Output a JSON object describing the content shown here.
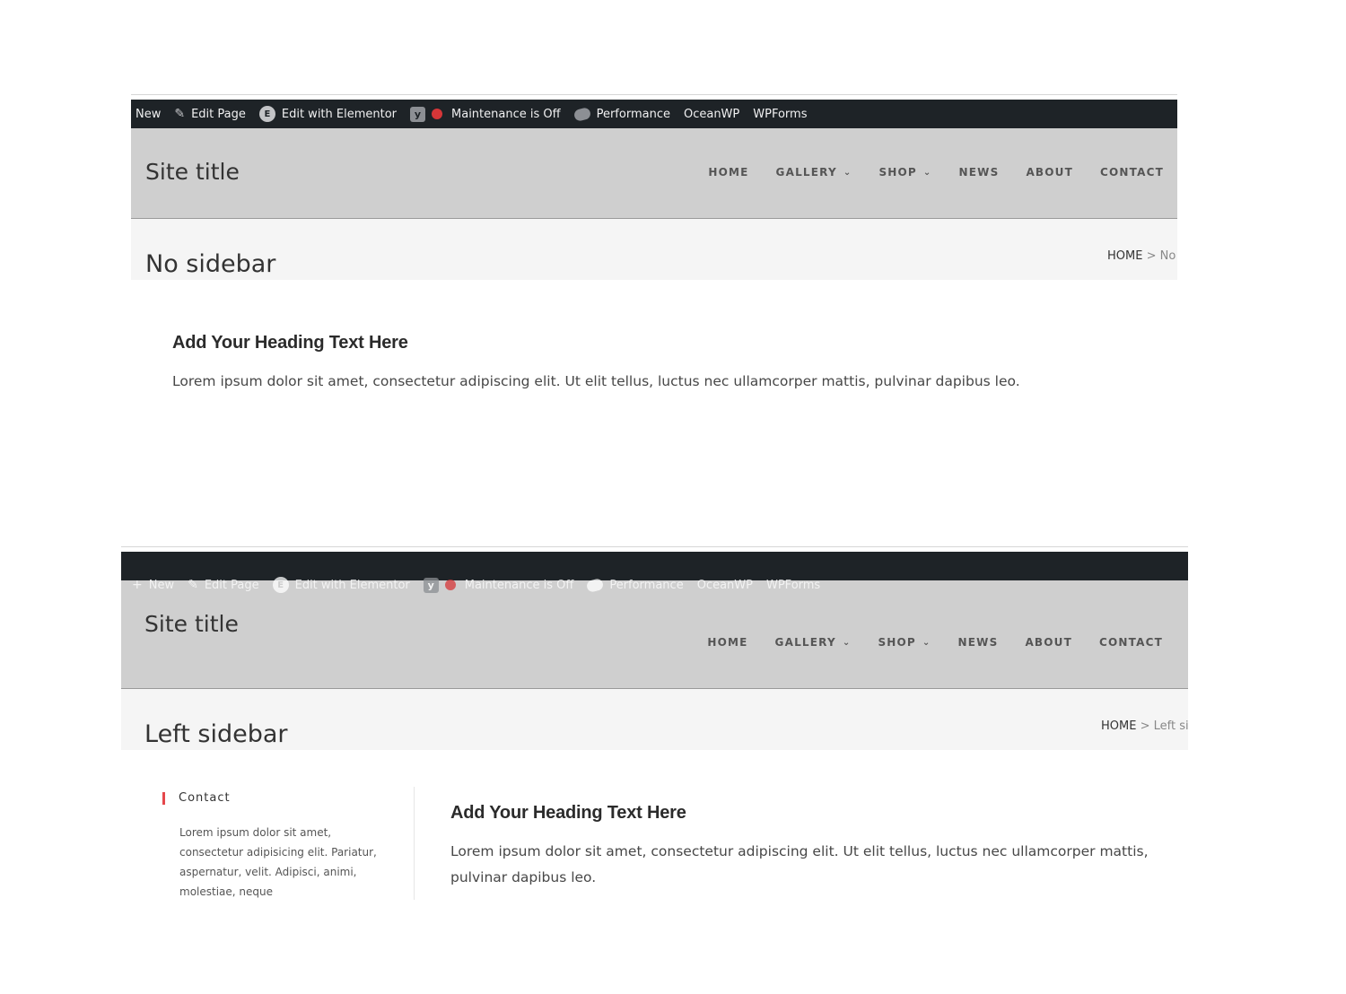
{
  "admin_bar": {
    "items": [
      {
        "icon": "plus-icon",
        "label": "New"
      },
      {
        "icon": "pencil-icon",
        "label": "Edit Page"
      },
      {
        "icon": "elementor-icon",
        "label": "Edit with Elementor"
      },
      {
        "icon": "yoast-icon",
        "label": ""
      },
      {
        "icon": "status-dot-icon",
        "label": "Maintenance is Off"
      },
      {
        "icon": "performance-icon",
        "label": "Performance"
      },
      {
        "icon": "",
        "label": "OceanWP"
      },
      {
        "icon": "",
        "label": "WPForms"
      }
    ],
    "colors": {
      "background": "#1e2327",
      "text": "#f0f0f1",
      "status_dot": "#d63638"
    }
  },
  "site": {
    "title": "Site title",
    "header_bg": "#cfcfcf",
    "nav": [
      {
        "label": "HOME",
        "dropdown": false
      },
      {
        "label": "GALLERY",
        "dropdown": true
      },
      {
        "label": "SHOP",
        "dropdown": true
      },
      {
        "label": "NEWS",
        "dropdown": false
      },
      {
        "label": "ABOUT",
        "dropdown": false
      },
      {
        "label": "CONTACT",
        "dropdown": false
      }
    ],
    "chevron": "⌄"
  },
  "screens": [
    {
      "page_title": "No sidebar",
      "breadcrumb": {
        "home": "HOME",
        "sep": ">",
        "current": "No"
      },
      "content": {
        "heading": "Add Your Heading Text Here",
        "text": "Lorem ipsum dolor sit amet, consectetur adipiscing elit. Ut elit tellus, luctus nec ullamcorper mattis, pulvinar dapibus leo."
      }
    },
    {
      "page_title": "Left sidebar",
      "breadcrumb": {
        "home": "HOME",
        "sep": ">",
        "current": "Left si"
      },
      "sidebar": {
        "widget_title": "Contact",
        "widget_text": "Lorem ipsum dolor sit amet, consectetur adipisicing elit. Pariatur, aspernatur, velit. Adipisci, animi, molestiae, neque",
        "accent": "#e5474b"
      },
      "content": {
        "heading": "Add Your Heading Text Here",
        "text": "Lorem ipsum dolor sit amet, consectetur adipiscing elit. Ut elit tellus, luctus nec ullamcorper mattis, pulvinar dapibus leo."
      }
    }
  ]
}
